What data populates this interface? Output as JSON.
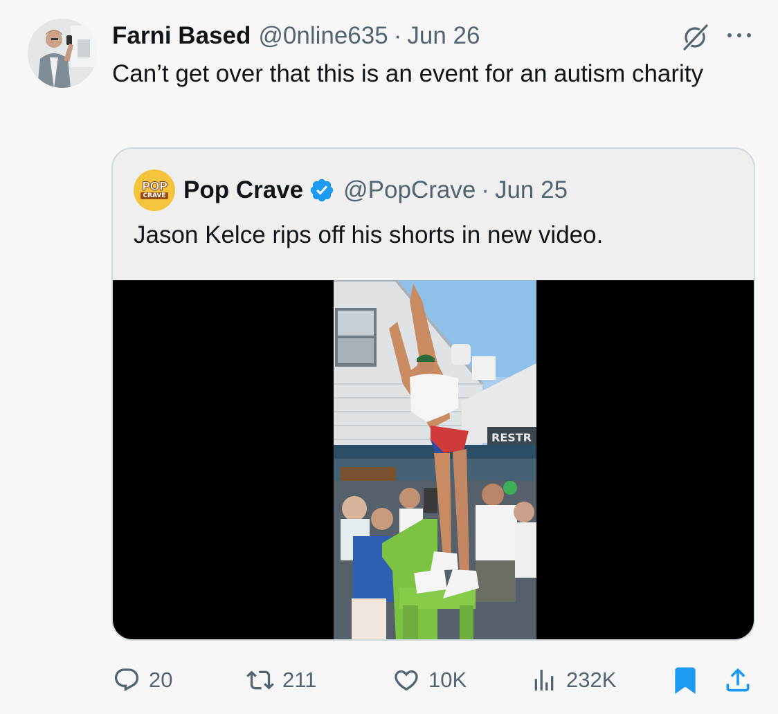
{
  "tweet": {
    "author_name": "Farni Based",
    "author_handle": "@0nline635",
    "separator": "·",
    "date": "Jun 26",
    "text": "Can’t get over that this is an event for an autism charity"
  },
  "quoted_tweet": {
    "logo_text_top": "POP",
    "logo_text_bottom": "CRAVE",
    "author_name": "Pop Crave",
    "author_handle": "@PopCrave",
    "separator": "·",
    "date": "Jun 25",
    "text": "Jason Kelce rips off his shorts in new video.",
    "media_sign_text": "RESTR"
  },
  "actions": {
    "replies": "20",
    "reposts": "211",
    "likes": "10K",
    "views": "232K"
  },
  "icons": {
    "avatar": "avatar-photo",
    "grok": "grok-icon",
    "more": "more-dots-icon",
    "verified": "verified-badge-icon",
    "reply": "reply-icon",
    "repost": "repost-icon",
    "like": "heart-icon",
    "views": "views-chart-icon",
    "bookmark": "bookmark-icon",
    "share": "share-icon"
  },
  "colors": {
    "background": "#f7f7f7",
    "text_primary": "#0f1419",
    "text_secondary": "#536471",
    "verified_blue": "#1d9bf0",
    "bookmark_blue": "#1d9bf0",
    "quote_border": "#cfd9de",
    "pop_crave_yellow": "#f4c53c"
  }
}
